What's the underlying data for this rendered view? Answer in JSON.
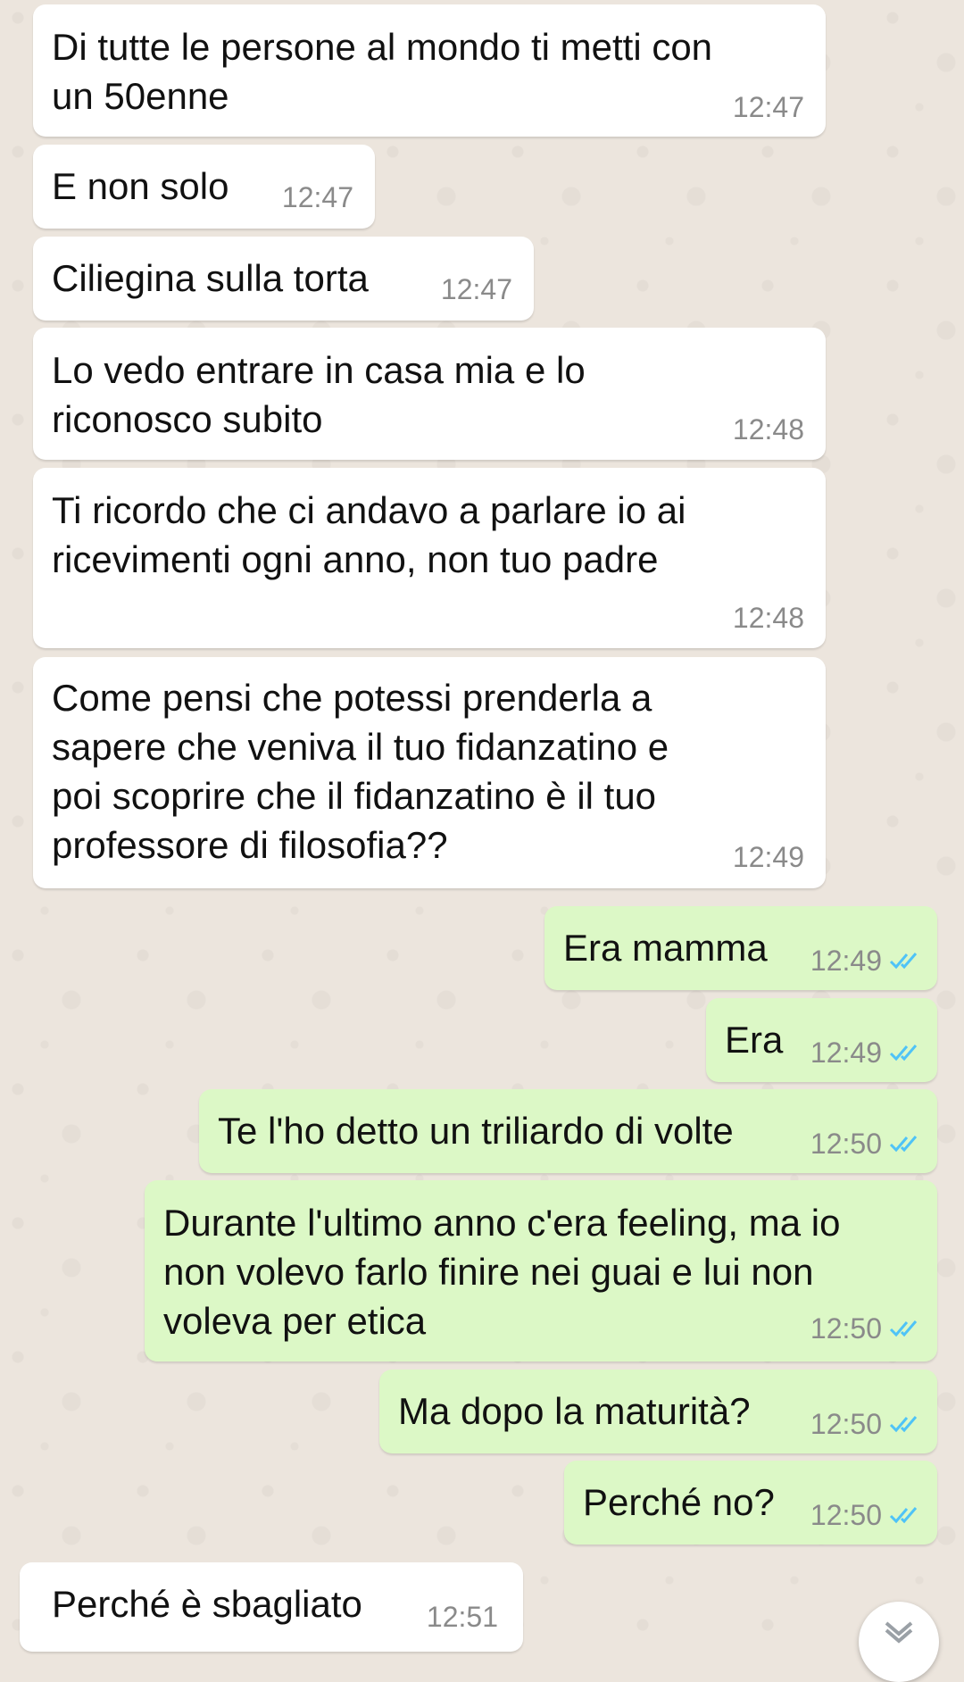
{
  "messages": [
    {
      "dir": "in",
      "text": "Di tutte le persone al mondo ti metti con\nun 50enne",
      "time": "12:47"
    },
    {
      "dir": "in",
      "text": "E non solo",
      "time": "12:47"
    },
    {
      "dir": "in",
      "text": "Ciliegina sulla torta",
      "time": "12:47"
    },
    {
      "dir": "in",
      "text": "Lo vedo entrare in casa mia e lo\nriconosco subito",
      "time": "12:48"
    },
    {
      "dir": "in",
      "text": "Ti ricordo che ci andavo a parlare io ai\nricevimenti ogni anno, non tuo padre",
      "time": "12:48"
    },
    {
      "dir": "in",
      "text": "Come pensi che potessi prenderla a\nsapere che veniva il tuo fidanzatino e\npoi scoprire che il fidanzatino è il tuo\nprofessore di filosofia??",
      "time": "12:49"
    },
    {
      "dir": "out",
      "text": "Era mamma",
      "time": "12:49",
      "status": "read"
    },
    {
      "dir": "out",
      "text": "Era",
      "time": "12:49",
      "status": "read"
    },
    {
      "dir": "out",
      "text": "Te l'ho detto un triliardo di volte",
      "time": "12:50",
      "status": "read"
    },
    {
      "dir": "out",
      "text": "Durante l'ultimo anno c'era feeling, ma io\nnon volevo farlo finire nei guai e lui non\nvoleva per etica",
      "time": "12:50",
      "status": "read"
    },
    {
      "dir": "out",
      "text": "Ma dopo la maturità?",
      "time": "12:50",
      "status": "read"
    },
    {
      "dir": "out",
      "text": "Perché no?",
      "time": "12:50",
      "status": "read"
    },
    {
      "dir": "in",
      "text": "Perché è sbagliato",
      "time": "12:51"
    }
  ],
  "colors": {
    "incoming_bubble": "#ffffff",
    "outgoing_bubble": "#dcf8c6",
    "read_ticks": "#4fc3f7",
    "wallpaper": "#ece5dd"
  },
  "icons": {
    "read_status": "double-check-icon",
    "scroll": "chevron-down-icon"
  }
}
